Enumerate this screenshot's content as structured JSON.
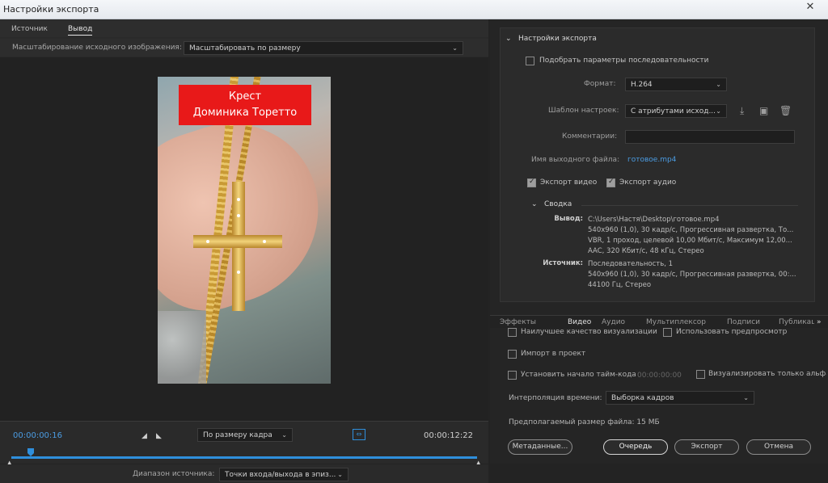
{
  "window": {
    "title": "Настройки экспорта",
    "close_icon": "close-icon"
  },
  "left": {
    "tabs": [
      "Источник",
      "Вывод"
    ],
    "active_tab": "Вывод",
    "scale_label": "Масштабирование исходного изображения:",
    "scale_value": "Масштабировать по размеру",
    "caption_line1": "Крест",
    "caption_line2": "Доминика Торетто",
    "time_current": "00:00:00:16",
    "time_end": "00:00:12:22",
    "fit_value": "По размеру кадра",
    "range_label": "Диапазон источника:",
    "range_value": "Точки входа/выхода в эпиз..."
  },
  "export": {
    "header": "Настройки экспорта",
    "match_seq": "Подобрать параметры последовательности",
    "format_label": "Формат:",
    "format_value": "H.264",
    "preset_label": "Шаблон настроек:",
    "preset_value": "С атрибутами исход...",
    "comments_label": "Комментарии:",
    "output_label": "Имя выходного файла:",
    "output_value": "готовое.mp4",
    "export_video": "Экспорт видео",
    "export_audio": "Экспорт аудио",
    "summary_header": "Сводка",
    "output_sum_label": "Вывод:",
    "output_lines": [
      "C:\\Users\\Настя\\Desktop\\готовое.mp4",
      "540x960 (1,0), 30 кадр/с, Прогрессивная развертка, То...",
      "VBR, 1 проход, целевой 10,00 Мбит/с, Максимум 12,00...",
      "AAC, 320 Кбит/с, 48 кГц, Стерео"
    ],
    "source_sum_label": "Источник:",
    "source_lines": [
      "Последовательность, 1",
      "540x960 (1,0), 30 кадр/с, Прогрессивная развертка, 00:...",
      "44100 Гц, Стерео"
    ]
  },
  "rtabs": [
    "Эффекты",
    "Видео",
    "Аудио",
    "Мультиплексор",
    "Подписи",
    "Публикац"
  ],
  "rtab_active": "Видео",
  "lower": {
    "best_quality": "Наилучшее качество визуализации",
    "use_previews": "Использовать предпросмотр",
    "import_project": "Импорт в проект",
    "set_timecode": "Установить начало тайм-кода",
    "timecode_value": "00:00:00:00",
    "render_alpha": "Визуализировать только альфа",
    "interp_label": "Интерполяция времени:",
    "interp_value": "Выборка кадров",
    "file_size": "Предполагаемый размер файла:  15 МБ"
  },
  "buttons": {
    "metadata": "Метаданные...",
    "queue": "Очередь",
    "export": "Экспорт",
    "cancel": "Отмена"
  }
}
